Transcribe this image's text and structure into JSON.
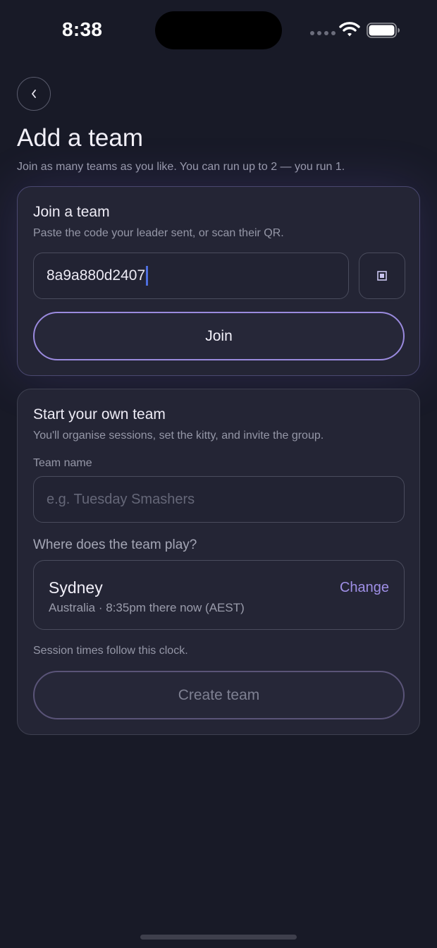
{
  "status_bar": {
    "time": "8:38"
  },
  "header": {
    "title": "Add a team",
    "subtitle": "Join as many teams as you like. You can run up to 2 — you run 1."
  },
  "join_card": {
    "title": "Join a team",
    "description": "Paste the code your leader sent, or scan their QR.",
    "code_value": "8a9a880d2407",
    "join_label": "Join"
  },
  "start_card": {
    "title": "Start your own team",
    "description": "You'll organise sessions, set the kitty, and invite the group.",
    "team_name_label": "Team name",
    "team_name_placeholder": "e.g. Tuesday Smashers",
    "team_name_value": "",
    "location_question": "Where does the team play?",
    "location": {
      "city": "Sydney",
      "detail": "Australia · 8:35pm there now (AEST)",
      "change_label": "Change"
    },
    "clock_note": "Session times follow this clock.",
    "create_label": "Create team"
  },
  "icons": {
    "back": "chevron-left-icon",
    "qr": "qr-scan-icon",
    "wifi": "wifi-icon",
    "battery": "battery-icon",
    "signal": "cellular-signal-icon"
  },
  "colors": {
    "background": "#181a27",
    "card": "#242535",
    "accent": "#9f8fe6",
    "join_border": "#9a8ade",
    "caret": "#4e6fe0"
  }
}
